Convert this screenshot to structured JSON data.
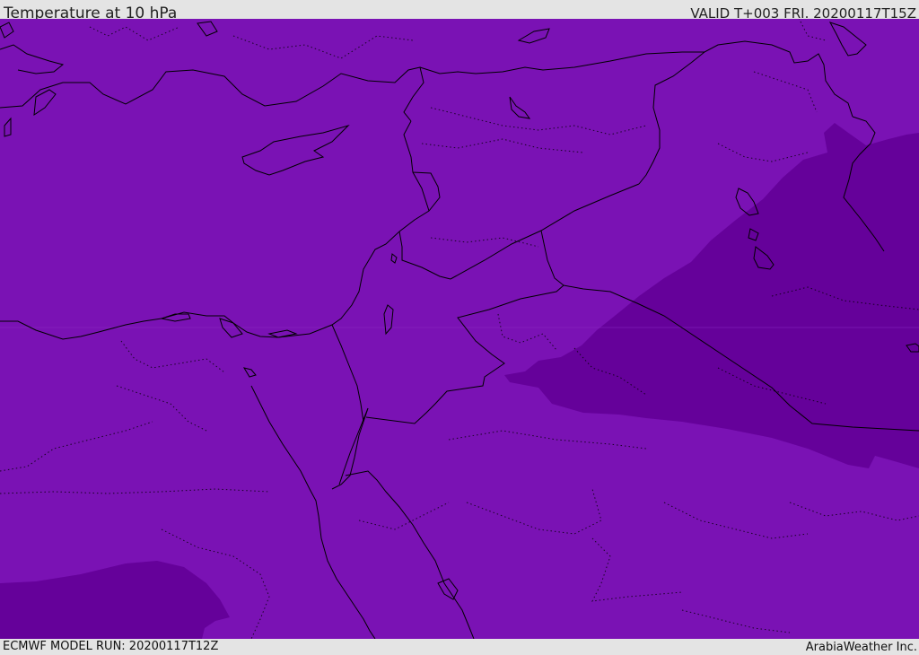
{
  "header": {
    "title": "Temperature at 10 hPa",
    "valid": "VALID T+003 FRI. 20200117T15Z"
  },
  "footer": {
    "model_run": "ECMWF MODEL RUN: 20200117T12Z",
    "credit": "ArabiaWeather Inc."
  },
  "map": {
    "colors": {
      "base_field": "#7a12b4",
      "cold_field": "#65019a",
      "boundaries": "#000000"
    }
  }
}
